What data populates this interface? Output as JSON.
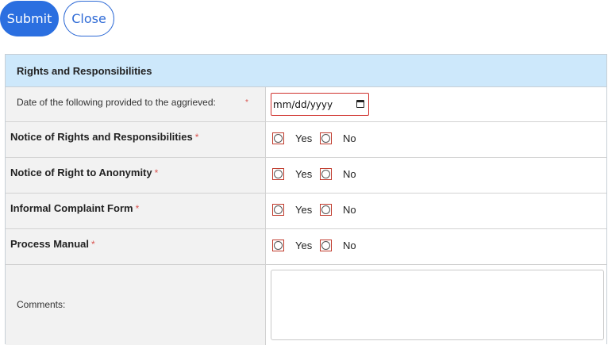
{
  "toolbar": {
    "submit_label": "Submit",
    "close_label": "Close"
  },
  "section": {
    "title": "Rights and Responsibilities",
    "date_row": {
      "label": "Date of the following provided to the aggrieved:",
      "required_mark": "*",
      "date_value": "mm/dd/yyyy"
    },
    "questions": [
      {
        "label": "Notice of Rights and Responsibilities",
        "required_mark": "*",
        "yes": "Yes",
        "no": "No"
      },
      {
        "label": "Notice of Right to Anonymity",
        "required_mark": "*",
        "yes": "Yes",
        "no": "No"
      },
      {
        "label": "Informal Complaint Form",
        "required_mark": "*",
        "yes": "Yes",
        "no": "No"
      },
      {
        "label": "Process Manual",
        "required_mark": "*",
        "yes": "Yes",
        "no": "No"
      }
    ],
    "comments": {
      "label": "Comments:",
      "value": ""
    }
  },
  "colors": {
    "primary": "#2b6fe0",
    "header_bg": "#cde8fb",
    "label_bg": "#f2f2f2",
    "required": "#d9534f",
    "invalid_border": "#d0312d"
  },
  "icons": {
    "date_picker": "calendar-icon"
  }
}
